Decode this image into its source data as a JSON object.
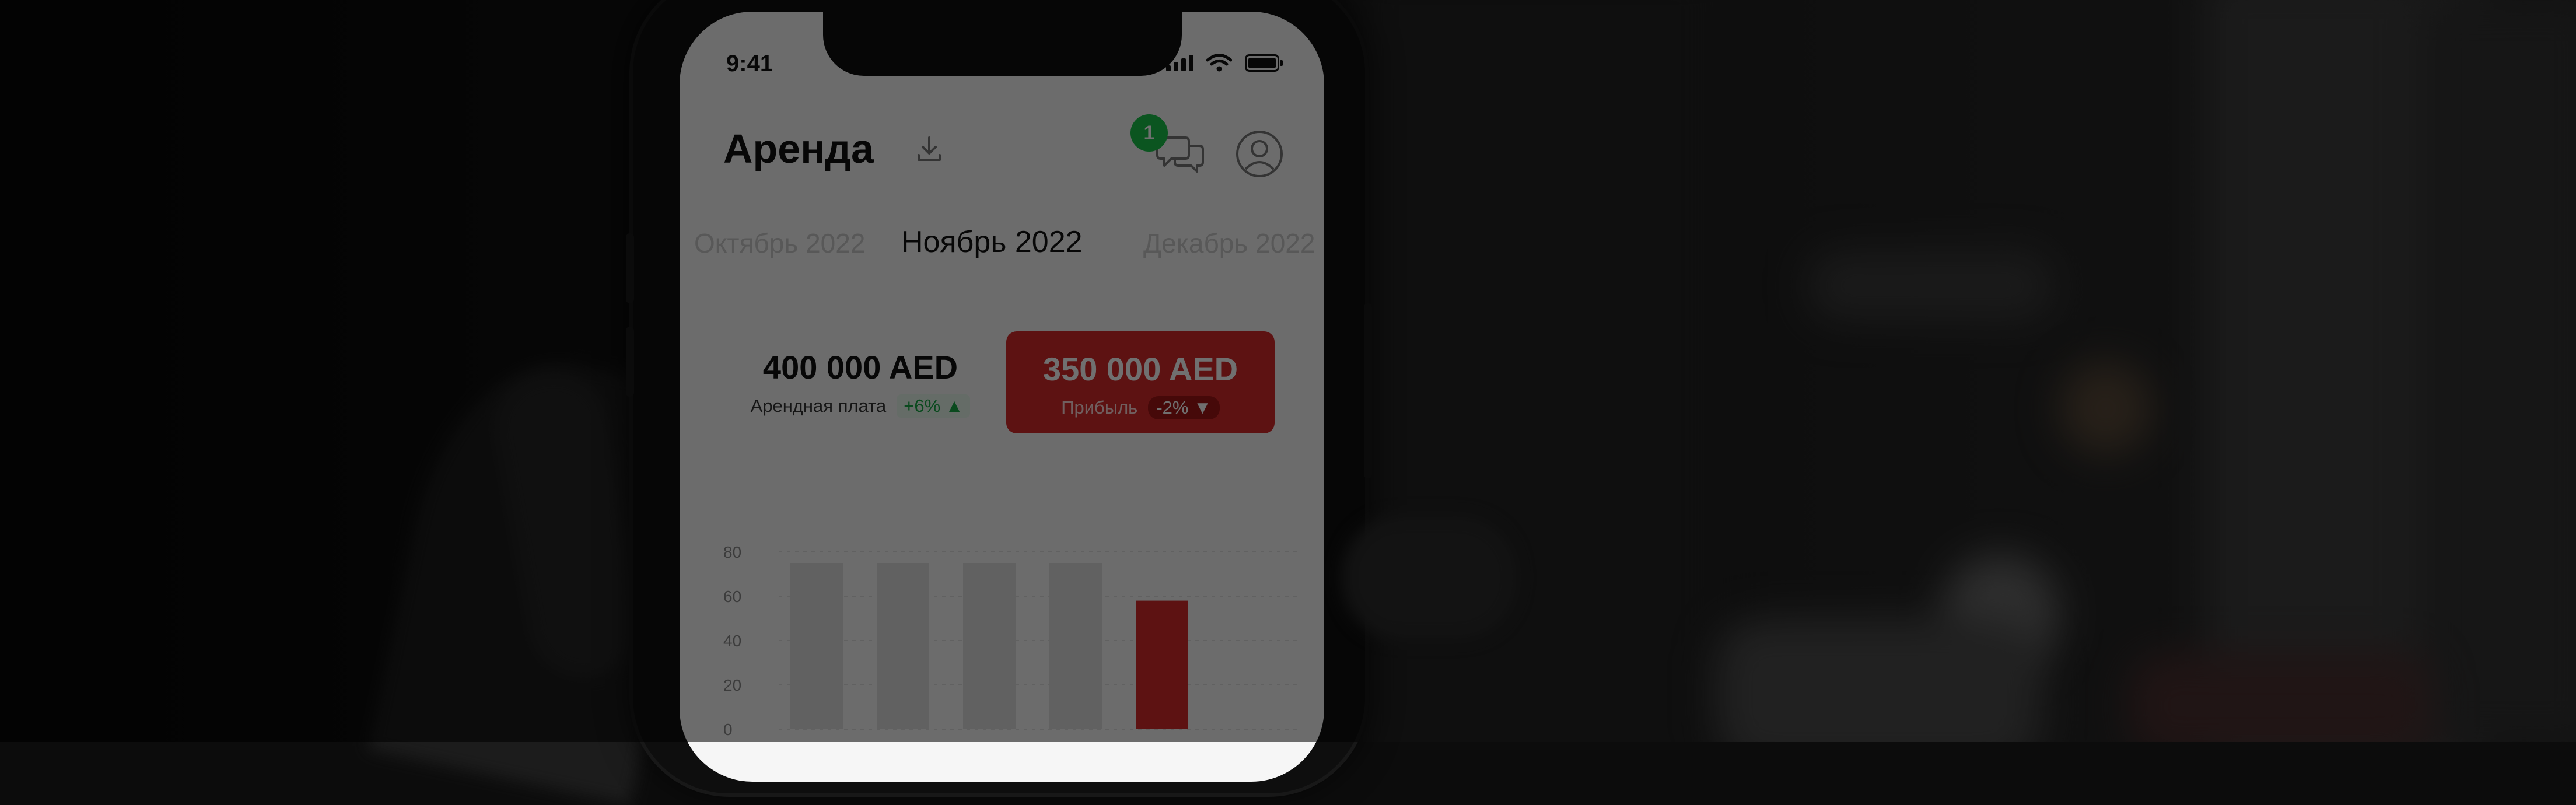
{
  "status_bar": {
    "time": "9:41"
  },
  "header": {
    "title": "Аренда",
    "notification_count": "1"
  },
  "months": {
    "previous": "Октябрь 2022",
    "current": "Ноябрь 2022",
    "next": "Декабрь 2022"
  },
  "stats": {
    "rent": {
      "value": "400 000 AED",
      "label": "Арендная плата",
      "change": "+6% ▲"
    },
    "profit": {
      "value": "350 000 AED",
      "label": "Прибыль",
      "change": "-2% ▼"
    }
  },
  "colors": {
    "accent_red": "#d42a2a",
    "badge_green": "#19c24a",
    "positive_green": "#17a845",
    "bar_gray": "#dddddd"
  },
  "chart_data": {
    "type": "bar",
    "categories": [
      "",
      "",
      "",
      "",
      "",
      ""
    ],
    "values": [
      75,
      75,
      75,
      75,
      58,
      0
    ],
    "highlight_index": 4,
    "ylim": [
      0,
      100
    ],
    "yticks": [
      "0",
      "20",
      "40",
      "60",
      "80"
    ],
    "grid": true
  }
}
